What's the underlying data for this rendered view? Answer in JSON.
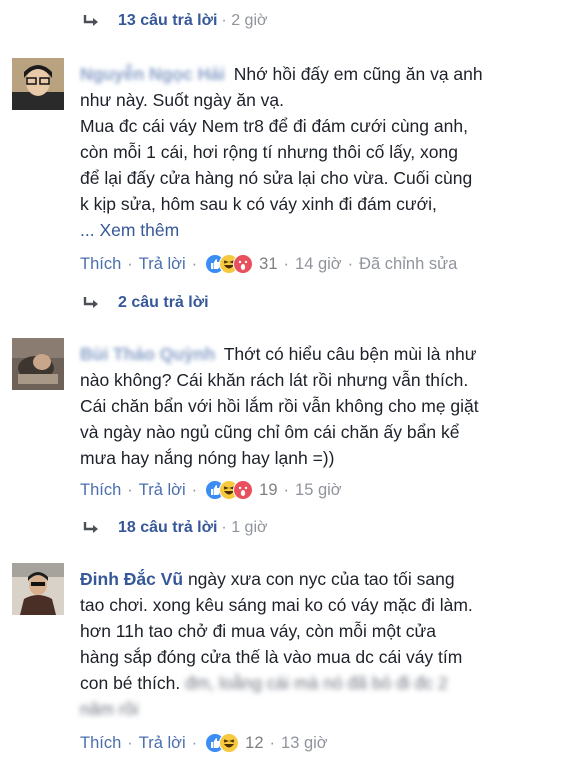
{
  "threads": [
    {
      "reply_count": "13 câu trả lời",
      "time": "· 2 giờ"
    },
    {
      "reply_count": "2 câu trả lời",
      "time": ""
    },
    {
      "reply_count": "18 câu trả lời",
      "time": "· 1 giờ"
    }
  ],
  "comments": [
    {
      "author": "Nguyễn Ngọc Hải",
      "author_blurred": true,
      "lines": [
        "Nhớ hồi đấy em cũng ăn vạ anh",
        "như này. Suốt ngày ăn vạ.",
        "Mua đc cái váy Nem tr8 để đi đám cưới cùng anh,",
        "còn mỗi 1 cái, hơi rộng tí nhưng thôi cố lấy, xong",
        "để lại đấy cửa hàng nó sửa lại cho vừa. Cuối cùng",
        "k kịp sửa, hôm sau k có váy xinh đi đám cưới,"
      ],
      "see_more": "... Xem thêm",
      "like": "Thích",
      "reply": "Trả lời",
      "reaction_count": "31",
      "time": "14 giờ",
      "edited": "Đã chỉnh sửa"
    },
    {
      "author": "Bùi Thảo Quỳnh",
      "author_blurred": true,
      "lines": [
        "Thớt có hiểu câu bện mùi là như",
        "nào không? Cái khăn rách lát rồi nhưng vẫn thích.",
        "Cái chăn bẩn với hồi lắm rồi vẫn không cho mẹ giặt",
        "và ngày nào ngủ cũng chỉ ôm cái chăn ấy bẩn kể",
        "mưa hay nắng nóng hay lạnh =))"
      ],
      "like": "Thích",
      "reply": "Trả lời",
      "reaction_count": "19",
      "time": "15 giờ"
    },
    {
      "author": "Đinh Đắc Vũ",
      "author_blurred": false,
      "lines": [
        "ngày xưa con nyc của tao tối sang",
        "tao chơi. xong kêu sáng mai ko có váy mặc đi làm.",
        "hơn 11h tao chở đi mua váy, còn mỗi một cửa",
        "hàng sắp đóng cửa thế là vào mua dc cái váy tím",
        "con bé thích."
      ],
      "blurred_tail": "đm, loằng cái mà nó đã bỏ đi đc 2",
      "blurred_line": "năm rồi",
      "like": "Thích",
      "reply": "Trả lời",
      "reaction_count": "12",
      "time": "13 giờ"
    }
  ],
  "colors": {
    "link": "#365899",
    "meta": "#90949c",
    "like_blue": "#3b8cf5",
    "haha_yellow": "#f7c93e",
    "wow_red": "#e9505d"
  }
}
